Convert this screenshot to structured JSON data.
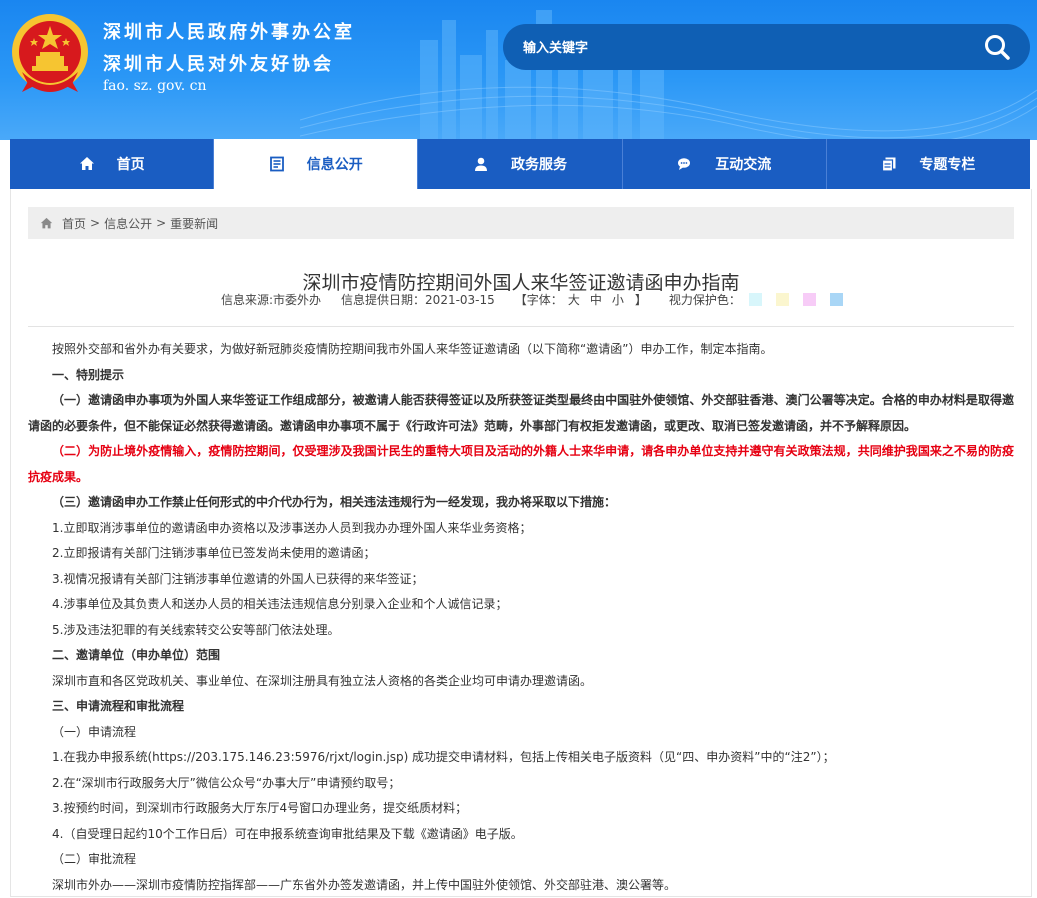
{
  "header": {
    "title_line1": "深圳市人民政府外事办公室",
    "title_line2": "深圳市人民对外友好协会",
    "domain": "fao. sz. gov. cn",
    "search_placeholder": "输入关键字",
    "emblem_icon": "national-emblem-icon",
    "search_icon": "search-icon"
  },
  "nav": {
    "items": [
      {
        "label": "首页",
        "icon": "home-icon"
      },
      {
        "label": "信息公开",
        "icon": "document-icon"
      },
      {
        "label": "政务服务",
        "icon": "user-icon"
      },
      {
        "label": "互动交流",
        "icon": "chat-icon"
      },
      {
        "label": "专题专栏",
        "icon": "copy-icon"
      }
    ],
    "active_index": 1
  },
  "breadcrumb": {
    "home": "首页",
    "section": "信息公开",
    "current": "重要新闻",
    "separator": ">"
  },
  "article": {
    "title": "深圳市疫情防控期间外国人来华签证邀请函申办指南",
    "source": "信息来源:市委外办",
    "date": "信息提供日期：2021-03-15",
    "font_size_prefix": "【字体：",
    "font_size_options": [
      "大",
      "中",
      "小"
    ],
    "font_size_suffix": "】",
    "eye_care_label": "视力保护色：",
    "eye_care_colors": [
      "#d8f6fb",
      "#fbf6cf",
      "#f7ccf7",
      "#a9d6f6"
    ],
    "paragraphs": [
      "按照外交部和省外办有关要求，为做好新冠肺炎疫情防控期间我市外国人来华签证邀请函（以下简称“邀请函”）申办工作，制定本指南。",
      "一、特别提示",
      "（一）邀请函申办事项为外国人来华签证工作组成部分，被邀请人能否获得签证以及所获签证类型最终由中国驻外使领馆、外交部驻香港、澳门公署等决定。合格的申办材料是取得邀请函的必要条件，但不能保证必然获得邀请函。邀请函申办事项不属于《行政许可法》范畴，外事部门有权拒发邀请函，或更改、取消已签发邀请函，并不予解释原因。",
      "（二）为防止境外疫情输入，疫情防控期间，仅受理涉及我国计民生的重特大项目及活动的外籍人士来华申请，请各申办单位支持并遵守有关政策法规，共同维护我国来之不易的防疫抗疫成果。",
      "（三）邀请函申办工作禁止任何形式的中介代办行为，相关违法违规行为一经发现，我办将采取以下措施：",
      "1.立即取消涉事单位的邀请函申办资格以及涉事送办人员到我办办理外国人来华业务资格；",
      "2.立即报请有关部门注销涉事单位已签发尚未使用的邀请函；",
      "3.视情况报请有关部门注销涉事单位邀请的外国人已获得的来华签证；",
      "4.涉事单位及其负责人和送办人员的相关违法违规信息分别录入企业和个人诚信记录；",
      "5.涉及违法犯罪的有关线索转交公安等部门依法处理。",
      "二、邀请单位（申办单位）范围",
      "深圳市直和各区党政机关、事业单位、在深圳注册具有独立法人资格的各类企业均可申请办理邀请函。",
      "三、申请流程和审批流程",
      "（一）申请流程",
      "1.在我办申报系统(https://203.175.146.23:5976/rjxt/login.jsp) 成功提交申请材料，包括上传相关电子版资料（见“四、申办资料”中的“注2”）；",
      "2.在“深圳市行政服务大厅”微信公众号“办事大厅”申请预约取号；",
      "3.按预约时间，到深圳市行政服务大厅东厅4号窗口办理业务，提交纸质材料；",
      "4.（自受理日起约10个工作日后）可在申报系统查询审批结果及下载《邀请函》电子版。",
      "（二）审批流程",
      "深圳市外办——深圳市疫情防控指挥部——广东省外办签发邀请函，并上传中国驻外使领馆、外交部驻港、澳公署等。"
    ]
  }
}
